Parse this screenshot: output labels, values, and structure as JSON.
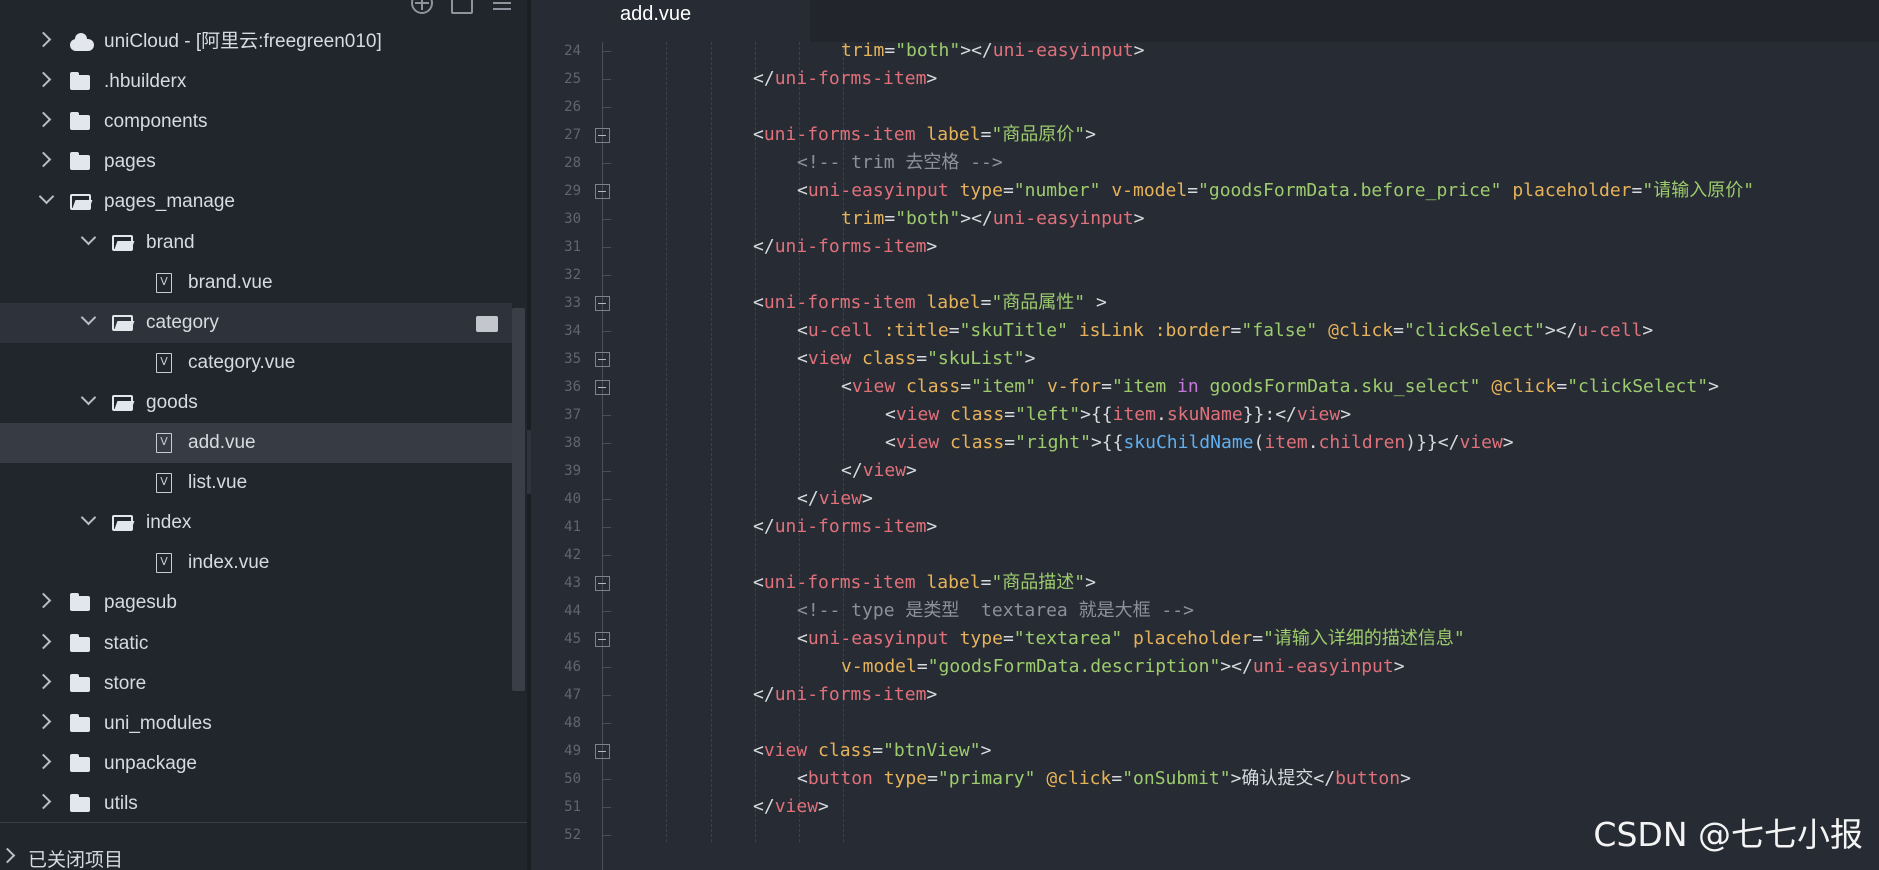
{
  "sidebar": {
    "tree": [
      {
        "label": "uniCloud - [阿里云:freegreen010]",
        "kind": "cloud",
        "expanded": false,
        "depth": 0
      },
      {
        "label": ".hbuilderx",
        "kind": "folder",
        "expanded": false,
        "depth": 0
      },
      {
        "label": "components",
        "kind": "folder",
        "expanded": false,
        "depth": 0
      },
      {
        "label": "pages",
        "kind": "folder",
        "expanded": false,
        "depth": 0
      },
      {
        "label": "pages_manage",
        "kind": "folder",
        "expanded": true,
        "depth": 0
      },
      {
        "label": "brand",
        "kind": "folder",
        "expanded": true,
        "depth": 1
      },
      {
        "label": "brand.vue",
        "kind": "file",
        "depth": 2
      },
      {
        "label": "category",
        "kind": "folder",
        "expanded": true,
        "depth": 1,
        "hovered": true
      },
      {
        "label": "category.vue",
        "kind": "file",
        "depth": 2
      },
      {
        "label": "goods",
        "kind": "folder",
        "expanded": true,
        "depth": 1
      },
      {
        "label": "add.vue",
        "kind": "file",
        "depth": 2,
        "selected": true
      },
      {
        "label": "list.vue",
        "kind": "file",
        "depth": 2
      },
      {
        "label": "index",
        "kind": "folder",
        "expanded": true,
        "depth": 1
      },
      {
        "label": "index.vue",
        "kind": "file",
        "depth": 2
      },
      {
        "label": "pagesub",
        "kind": "folder",
        "expanded": false,
        "depth": 0
      },
      {
        "label": "static",
        "kind": "folder",
        "expanded": false,
        "depth": 0
      },
      {
        "label": "store",
        "kind": "folder",
        "expanded": false,
        "depth": 0
      },
      {
        "label": "uni_modules",
        "kind": "folder",
        "expanded": false,
        "depth": 0
      },
      {
        "label": "unpackage",
        "kind": "folder",
        "expanded": false,
        "depth": 0
      },
      {
        "label": "utils",
        "kind": "folder",
        "expanded": false,
        "depth": 0
      }
    ],
    "file_icon_glyph": "V",
    "closed_projects_label": "已关闭项目",
    "top_icons": [
      "crosshair-icon",
      "copy-icon",
      "menu-icon"
    ]
  },
  "editor": {
    "active_tab": "add.vue",
    "lines": [
      {
        "n": "24",
        "indent": 5,
        "fold": false,
        "tokens": [
          [
            "attr",
            "trim"
          ],
          [
            "br",
            "="
          ],
          [
            "str",
            "\"both\""
          ],
          [
            "br",
            "></"
          ],
          [
            "tag",
            "uni-easyinput"
          ],
          [
            "br",
            ">"
          ]
        ]
      },
      {
        "n": "25",
        "indent": 3,
        "fold": false,
        "tokens": [
          [
            "br",
            "</"
          ],
          [
            "tag",
            "uni-forms-item"
          ],
          [
            "br",
            ">"
          ]
        ]
      },
      {
        "n": "26",
        "indent": 0,
        "fold": false,
        "tokens": []
      },
      {
        "n": "27",
        "indent": 3,
        "fold": true,
        "tokens": [
          [
            "br",
            "<"
          ],
          [
            "tag",
            "uni-forms-item"
          ],
          [
            "br",
            " "
          ],
          [
            "attr",
            "label"
          ],
          [
            "br",
            "="
          ],
          [
            "str",
            "\"商品原价\""
          ],
          [
            "br",
            ">"
          ]
        ]
      },
      {
        "n": "28",
        "indent": 4,
        "fold": false,
        "tokens": [
          [
            "cm",
            "<!-- trim 去空格 -->"
          ]
        ]
      },
      {
        "n": "29",
        "indent": 4,
        "fold": true,
        "tokens": [
          [
            "br",
            "<"
          ],
          [
            "tag",
            "uni-easyinput"
          ],
          [
            "br",
            " "
          ],
          [
            "attr",
            "type"
          ],
          [
            "br",
            "="
          ],
          [
            "str",
            "\"number\""
          ],
          [
            "br",
            " "
          ],
          [
            "attr",
            "v-model"
          ],
          [
            "br",
            "="
          ],
          [
            "str",
            "\"goodsFormData.before_price\""
          ],
          [
            "br",
            " "
          ],
          [
            "attr",
            "placeholder"
          ],
          [
            "br",
            "="
          ],
          [
            "str",
            "\"请输入原价\""
          ]
        ]
      },
      {
        "n": "30",
        "indent": 5,
        "fold": false,
        "tokens": [
          [
            "attr",
            "trim"
          ],
          [
            "br",
            "="
          ],
          [
            "str",
            "\"both\""
          ],
          [
            "br",
            "></"
          ],
          [
            "tag",
            "uni-easyinput"
          ],
          [
            "br",
            ">"
          ]
        ]
      },
      {
        "n": "31",
        "indent": 3,
        "fold": false,
        "tokens": [
          [
            "br",
            "</"
          ],
          [
            "tag",
            "uni-forms-item"
          ],
          [
            "br",
            ">"
          ]
        ]
      },
      {
        "n": "32",
        "indent": 0,
        "fold": false,
        "tokens": []
      },
      {
        "n": "33",
        "indent": 3,
        "fold": true,
        "tokens": [
          [
            "br",
            "<"
          ],
          [
            "tag",
            "uni-forms-item"
          ],
          [
            "br",
            " "
          ],
          [
            "attr",
            "label"
          ],
          [
            "br",
            "="
          ],
          [
            "str",
            "\"商品属性\""
          ],
          [
            "br",
            " >"
          ]
        ]
      },
      {
        "n": "34",
        "indent": 4,
        "fold": false,
        "tokens": [
          [
            "br",
            "<"
          ],
          [
            "tag",
            "u-cell"
          ],
          [
            "br",
            " "
          ],
          [
            "attr",
            ":title"
          ],
          [
            "br",
            "="
          ],
          [
            "str",
            "\"skuTitle\""
          ],
          [
            "br",
            " "
          ],
          [
            "attr",
            "isLink"
          ],
          [
            "br",
            " "
          ],
          [
            "attr",
            ":border"
          ],
          [
            "br",
            "="
          ],
          [
            "str",
            "\"false\""
          ],
          [
            "br",
            " "
          ],
          [
            "attr",
            "@click"
          ],
          [
            "br",
            "="
          ],
          [
            "str",
            "\"clickSelect\""
          ],
          [
            "br",
            "></"
          ],
          [
            "tag",
            "u-cell"
          ],
          [
            "br",
            ">"
          ]
        ]
      },
      {
        "n": "35",
        "indent": 4,
        "fold": true,
        "tokens": [
          [
            "br",
            "<"
          ],
          [
            "tag",
            "view"
          ],
          [
            "br",
            " "
          ],
          [
            "attr",
            "class"
          ],
          [
            "br",
            "="
          ],
          [
            "str",
            "\"skuList\""
          ],
          [
            "br",
            ">"
          ]
        ]
      },
      {
        "n": "36",
        "indent": 5,
        "fold": true,
        "tokens": [
          [
            "br",
            "<"
          ],
          [
            "tag",
            "view"
          ],
          [
            "br",
            " "
          ],
          [
            "attr",
            "class"
          ],
          [
            "br",
            "="
          ],
          [
            "str",
            "\"item\""
          ],
          [
            "br",
            " "
          ],
          [
            "attr",
            "v-for"
          ],
          [
            "br",
            "="
          ],
          [
            "str",
            "\"item "
          ],
          [
            "kw",
            "in"
          ],
          [
            "str",
            " goodsFormData.sku_select\""
          ],
          [
            "br",
            " "
          ],
          [
            "attr",
            "@click"
          ],
          [
            "br",
            "="
          ],
          [
            "str",
            "\"clickSelect\""
          ],
          [
            "br",
            ">"
          ]
        ]
      },
      {
        "n": "37",
        "indent": 6,
        "fold": false,
        "tokens": [
          [
            "br",
            "<"
          ],
          [
            "tag",
            "view"
          ],
          [
            "br",
            " "
          ],
          [
            "attr",
            "class"
          ],
          [
            "br",
            "="
          ],
          [
            "str",
            "\"left\""
          ],
          [
            "br",
            ">{{"
          ],
          [
            "tag",
            "item"
          ],
          [
            "br",
            "."
          ],
          [
            "tag",
            "skuName"
          ],
          [
            "br",
            "}}:</"
          ],
          [
            "tag",
            "view"
          ],
          [
            "br",
            ">"
          ]
        ]
      },
      {
        "n": "38",
        "indent": 6,
        "fold": false,
        "tokens": [
          [
            "br",
            "<"
          ],
          [
            "tag",
            "view"
          ],
          [
            "br",
            " "
          ],
          [
            "attr",
            "class"
          ],
          [
            "br",
            "="
          ],
          [
            "str",
            "\"right\""
          ],
          [
            "br",
            ">{{"
          ],
          [
            "fn",
            "skuChildName"
          ],
          [
            "br",
            "("
          ],
          [
            "tag",
            "item"
          ],
          [
            "br",
            "."
          ],
          [
            "tag",
            "children"
          ],
          [
            "br",
            ")}}</"
          ],
          [
            "tag",
            "view"
          ],
          [
            "br",
            ">"
          ]
        ]
      },
      {
        "n": "39",
        "indent": 5,
        "fold": false,
        "tokens": [
          [
            "br",
            "</"
          ],
          [
            "tag",
            "view"
          ],
          [
            "br",
            ">"
          ]
        ]
      },
      {
        "n": "40",
        "indent": 4,
        "fold": false,
        "tokens": [
          [
            "br",
            "</"
          ],
          [
            "tag",
            "view"
          ],
          [
            "br",
            ">"
          ]
        ]
      },
      {
        "n": "41",
        "indent": 3,
        "fold": false,
        "tokens": [
          [
            "br",
            "</"
          ],
          [
            "tag",
            "uni-forms-item"
          ],
          [
            "br",
            ">"
          ]
        ]
      },
      {
        "n": "42",
        "indent": 0,
        "fold": false,
        "tokens": []
      },
      {
        "n": "43",
        "indent": 3,
        "fold": true,
        "tokens": [
          [
            "br",
            "<"
          ],
          [
            "tag",
            "uni-forms-item"
          ],
          [
            "br",
            " "
          ],
          [
            "attr",
            "label"
          ],
          [
            "br",
            "="
          ],
          [
            "str",
            "\"商品描述\""
          ],
          [
            "br",
            ">"
          ]
        ]
      },
      {
        "n": "44",
        "indent": 4,
        "fold": false,
        "tokens": [
          [
            "cm",
            "<!-- type 是类型  textarea 就是大框 -->"
          ]
        ]
      },
      {
        "n": "45",
        "indent": 4,
        "fold": true,
        "tokens": [
          [
            "br",
            "<"
          ],
          [
            "tag",
            "uni-easyinput"
          ],
          [
            "br",
            " "
          ],
          [
            "attr",
            "type"
          ],
          [
            "br",
            "="
          ],
          [
            "str",
            "\"textarea\""
          ],
          [
            "br",
            " "
          ],
          [
            "attr",
            "placeholder"
          ],
          [
            "br",
            "="
          ],
          [
            "str",
            "\"请输入详细的描述信息\""
          ]
        ]
      },
      {
        "n": "46",
        "indent": 5,
        "fold": false,
        "tokens": [
          [
            "attr",
            "v-model"
          ],
          [
            "br",
            "="
          ],
          [
            "str",
            "\"goodsFormData.description\""
          ],
          [
            "br",
            "></"
          ],
          [
            "tag",
            "uni-easyinput"
          ],
          [
            "br",
            ">"
          ]
        ]
      },
      {
        "n": "47",
        "indent": 3,
        "fold": false,
        "tokens": [
          [
            "br",
            "</"
          ],
          [
            "tag",
            "uni-forms-item"
          ],
          [
            "br",
            ">"
          ]
        ]
      },
      {
        "n": "48",
        "indent": 0,
        "fold": false,
        "tokens": []
      },
      {
        "n": "49",
        "indent": 3,
        "fold": true,
        "tokens": [
          [
            "br",
            "<"
          ],
          [
            "tag",
            "view"
          ],
          [
            "br",
            " "
          ],
          [
            "attr",
            "class"
          ],
          [
            "br",
            "="
          ],
          [
            "str",
            "\"btnView\""
          ],
          [
            "br",
            ">"
          ]
        ]
      },
      {
        "n": "50",
        "indent": 4,
        "fold": false,
        "tokens": [
          [
            "br",
            "<"
          ],
          [
            "tag",
            "button"
          ],
          [
            "br",
            " "
          ],
          [
            "attr",
            "type"
          ],
          [
            "br",
            "="
          ],
          [
            "str",
            "\"primary\""
          ],
          [
            "br",
            " "
          ],
          [
            "attr",
            "@click"
          ],
          [
            "br",
            "="
          ],
          [
            "str",
            "\"onSubmit\""
          ],
          [
            "br",
            ">确认提交</"
          ],
          [
            "tag",
            "button"
          ],
          [
            "br",
            ">"
          ]
        ]
      },
      {
        "n": "51",
        "indent": 3,
        "fold": false,
        "tokens": [
          [
            "br",
            "</"
          ],
          [
            "tag",
            "view"
          ],
          [
            "br",
            ">"
          ]
        ]
      },
      {
        "n": "52",
        "indent": 0,
        "fold": false,
        "tokens": []
      }
    ]
  },
  "watermark": "CSDN @七七小报"
}
